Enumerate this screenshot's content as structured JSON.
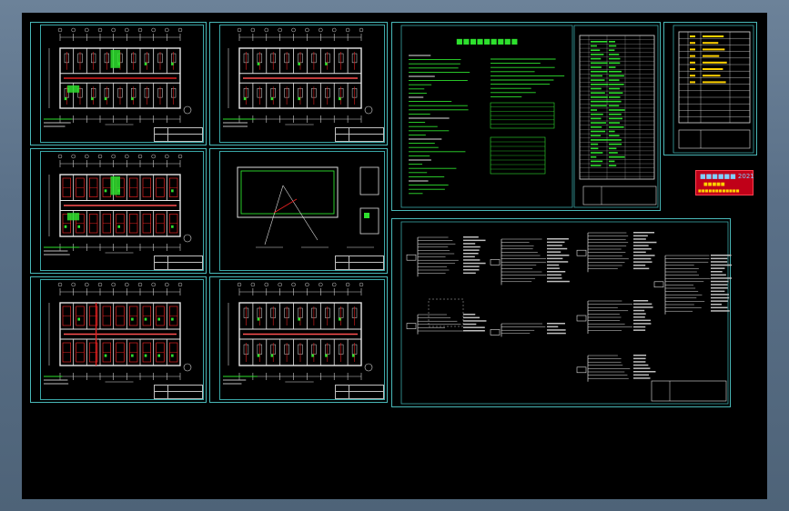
{
  "colors": {
    "background": "#5a7088",
    "canvas": "#000000",
    "sheet_border": "#49b8b8",
    "walls": "#e6e6e6",
    "green": "#2ee02e",
    "red": "#e02020",
    "yellow": "#ffd200"
  },
  "watermark": {
    "line1": "■■■■■■ 2021",
    "line2": "■■■■■",
    "line3": "■■■■■■■■■■■■"
  },
  "sheets": [
    {
      "id": "plan-1",
      "type": "floor-plan",
      "caption": "■■■■■■ 1:100"
    },
    {
      "id": "plan-2",
      "type": "floor-plan",
      "caption": "■■■■■■ 1:100"
    },
    {
      "id": "plan-3",
      "type": "floor-plan",
      "caption": "■■■■■■ 1:100"
    },
    {
      "id": "plan-4",
      "type": "roof-plan",
      "caption": "■■■■■■ 1:100"
    },
    {
      "id": "plan-5",
      "type": "floor-plan",
      "caption": "■■■■■■ 1:100"
    },
    {
      "id": "plan-6",
      "type": "floor-plan",
      "caption": "■■■■■■ 1:100"
    },
    {
      "id": "notes",
      "type": "design-notes",
      "title": "■■■■■■■■■"
    },
    {
      "id": "materials",
      "type": "material-table",
      "title": "■■■■■■"
    },
    {
      "id": "index",
      "type": "drawing-index",
      "title": "■■■■■■"
    },
    {
      "id": "system",
      "type": "system-diagram",
      "caption": "■■■■■■■■■"
    }
  ]
}
